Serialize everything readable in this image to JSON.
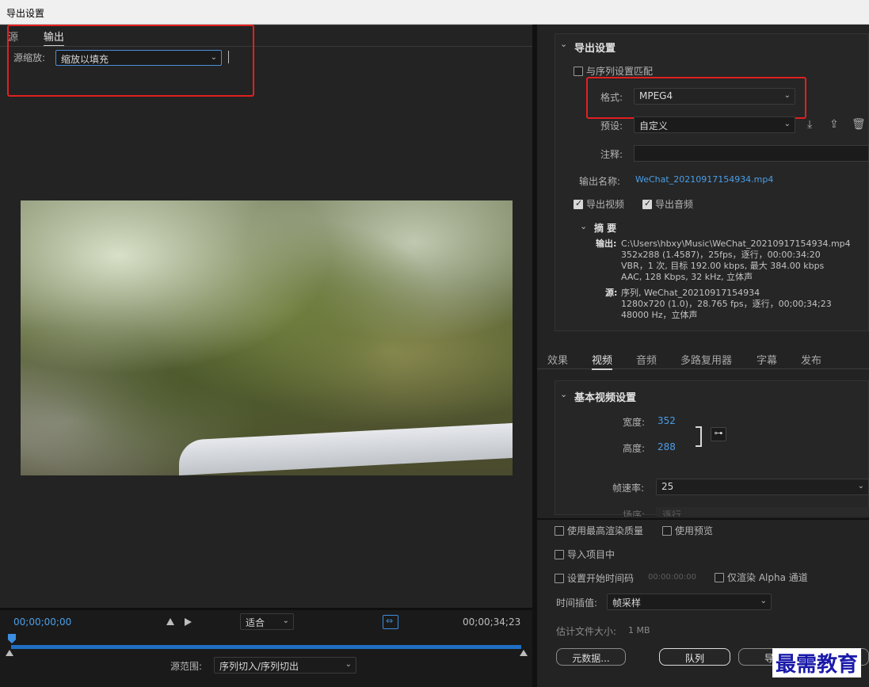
{
  "window": {
    "title": "导出设置"
  },
  "left": {
    "tabs": [
      {
        "label": "源"
      },
      {
        "label": "输出"
      }
    ],
    "scale_label": "源缩放:",
    "scale_value": "缩放以填充",
    "timecode_start": "00;00;00;00",
    "timecode_end": "00;00;34;23",
    "fit_value": "适合",
    "range_label": "源范围:",
    "range_value": "序列切入/序列切出"
  },
  "export_settings": {
    "header": "导出设置",
    "match_sequence": "与序列设置匹配",
    "format_label": "格式:",
    "format_value": "MPEG4",
    "preset_label": "预设:",
    "preset_value": "自定义",
    "comment_label": "注释:",
    "output_name_label": "输出名称:",
    "output_name_value": "WeChat_20210917154934.mp4",
    "export_video": "导出视频",
    "export_audio": "导出音频",
    "summary_header": "摘 要",
    "output_key": "输出:",
    "output_lines": [
      "C:\\Users\\hbxy\\Music\\WeChat_20210917154934.mp4",
      "352x288 (1.4587)，25fps，逐行，00:00:34:20",
      "VBR，1 次, 目标 192.00 kbps, 最大 384.00 kbps",
      "AAC, 128 Kbps, 32  kHz, 立体声"
    ],
    "source_key": "源:",
    "source_lines": [
      "序列, WeChat_20210917154934",
      "1280x720 (1.0)，28.765 fps，逐行，00;00;34;23",
      "48000 Hz，立体声"
    ]
  },
  "right_tabs": [
    {
      "label": "效果"
    },
    {
      "label": "视频"
    },
    {
      "label": "音频"
    },
    {
      "label": "多路复用器"
    },
    {
      "label": "字幕"
    },
    {
      "label": "发布"
    }
  ],
  "video_settings": {
    "header": "基本视频设置",
    "width_label": "宽度:",
    "width_value": "352",
    "height_label": "高度:",
    "height_value": "288",
    "framerate_label": "帧速率:",
    "framerate_value": "25",
    "field_label": "场序:",
    "field_value": "逐行"
  },
  "bottom": {
    "max_render": "使用最高渲染质量",
    "use_preview": "使用预览",
    "import_project": "导入项目中",
    "set_start_tc": "设置开始时间码",
    "start_tc_value": "00:00:00:00",
    "alpha_only": "仅渲染 Alpha 通道",
    "interp_label": "时间插值:",
    "interp_value": "帧采样",
    "filesize_label": "估计文件大小:",
    "filesize_value": "1 MB",
    "metadata_btn": "元数据...",
    "queue_btn": "队列",
    "export_btn": "导出"
  },
  "watermark": "最需教育"
}
